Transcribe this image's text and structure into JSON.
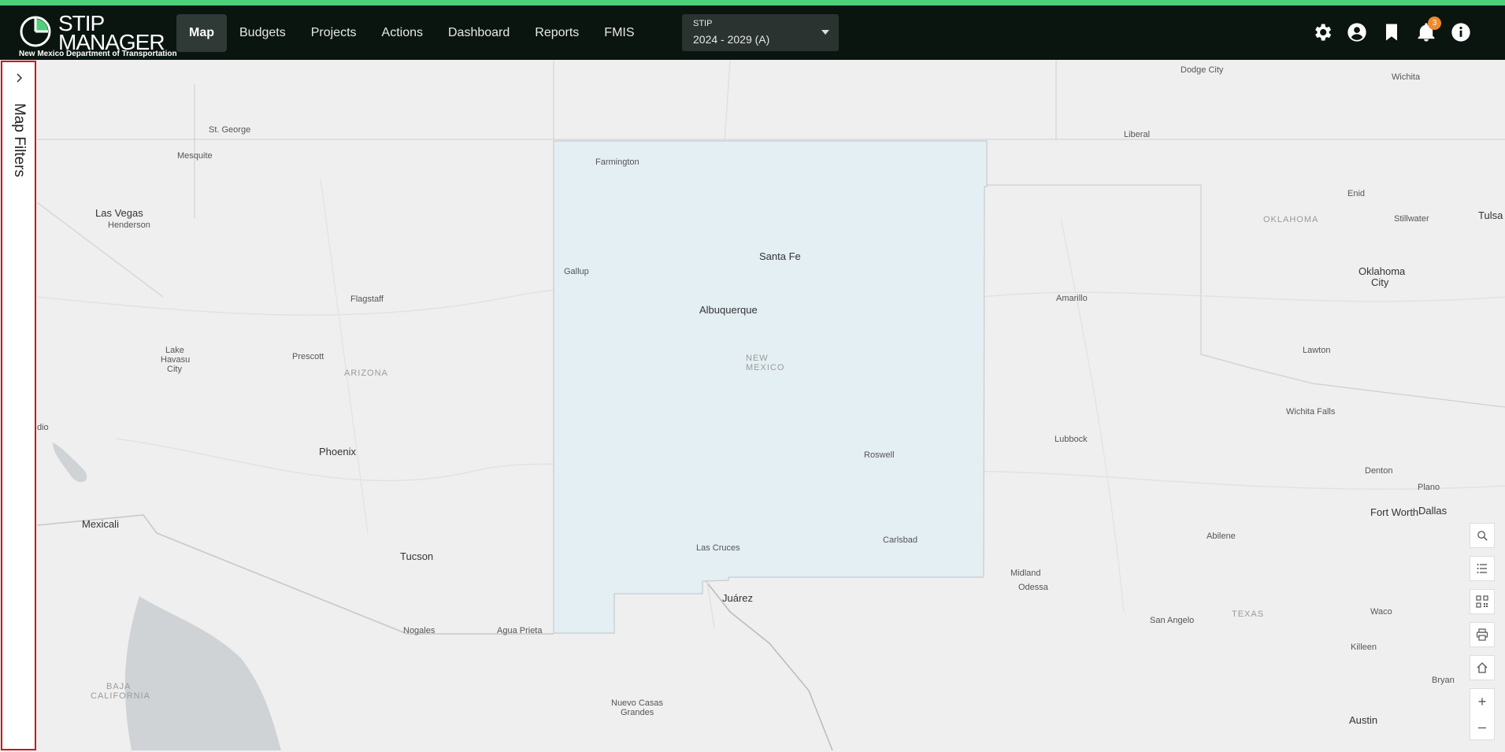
{
  "brand": {
    "title_line1": "STIP",
    "title_line2": "MANAGER",
    "subtitle": "New Mexico Department of Transportation"
  },
  "nav": {
    "items": [
      {
        "label": "Map",
        "active": true
      },
      {
        "label": "Budgets"
      },
      {
        "label": "Projects"
      },
      {
        "label": "Actions"
      },
      {
        "label": "Dashboard"
      },
      {
        "label": "Reports"
      },
      {
        "label": "FMIS"
      }
    ]
  },
  "stip_select": {
    "label": "STIP",
    "value": "2024 - 2029 (A)"
  },
  "header_icons": {
    "settings": "gear-icon",
    "account": "user-icon",
    "bookmark": "bookmark-icon",
    "notifications": "bell-icon",
    "notification_count": "3",
    "info": "info-icon"
  },
  "sidebar": {
    "label": "Map Filters"
  },
  "map": {
    "labels": [
      {
        "name": "Dodge City"
      },
      {
        "name": "Wichita"
      },
      {
        "name": "St. George"
      },
      {
        "name": "Liberal"
      },
      {
        "name": "Mesquite"
      },
      {
        "name": "Farmington"
      },
      {
        "name": "Las Vegas"
      },
      {
        "name": "Henderson"
      },
      {
        "name": "Enid"
      },
      {
        "name": "Stillwater"
      },
      {
        "name": "Tulsa"
      },
      {
        "name": "OKLAHOMA"
      },
      {
        "name": "Santa Fe"
      },
      {
        "name": "Gallup"
      },
      {
        "name": "Oklahoma"
      },
      {
        "name": "City"
      },
      {
        "name": "Flagstaff"
      },
      {
        "name": "Amarillo"
      },
      {
        "name": "Albuquerque"
      },
      {
        "name": "Lake"
      },
      {
        "name": "Havasu"
      },
      {
        "name": "City"
      },
      {
        "name": "Lawton"
      },
      {
        "name": "Prescott"
      },
      {
        "name": "NEW"
      },
      {
        "name": "MEXICO"
      },
      {
        "name": "ARIZONA"
      },
      {
        "name": "Wichita Falls"
      },
      {
        "name": "dio"
      },
      {
        "name": "Lubbock"
      },
      {
        "name": "Phoenix"
      },
      {
        "name": "Roswell"
      },
      {
        "name": "Denton"
      },
      {
        "name": "Plano"
      },
      {
        "name": "Fort Worth"
      },
      {
        "name": "Dallas"
      },
      {
        "name": "Mexicali"
      },
      {
        "name": "Abilene"
      },
      {
        "name": "Carlsbad"
      },
      {
        "name": "Las Cruces"
      },
      {
        "name": "Tucson"
      },
      {
        "name": "Midland"
      },
      {
        "name": "Odessa"
      },
      {
        "name": "Juárez"
      },
      {
        "name": "TEXAS"
      },
      {
        "name": "Waco"
      },
      {
        "name": "San Angelo"
      },
      {
        "name": "Nogales"
      },
      {
        "name": "Agua Prieta"
      },
      {
        "name": "Killeen"
      },
      {
        "name": "BAJA"
      },
      {
        "name": "CALIFORNIA"
      },
      {
        "name": "Bryan"
      },
      {
        "name": "Nuevo Casas"
      },
      {
        "name": "Grandes"
      },
      {
        "name": "Austin"
      }
    ]
  },
  "map_controls": {
    "search": "search-icon",
    "legend": "list-icon",
    "qr": "qr-code-icon",
    "print": "print-icon",
    "home": "home-icon",
    "zoom_in": "+",
    "zoom_out": "–"
  }
}
